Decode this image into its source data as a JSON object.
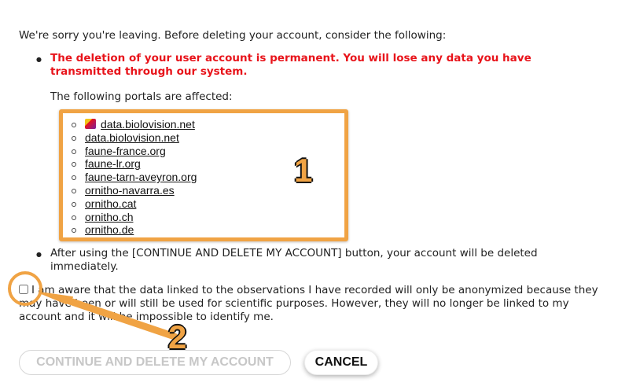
{
  "intro": "We're sorry you're leaving. Before deleting your account, consider the following:",
  "warning": "The deletion of your user account is permanent. You will lose any data you have transmitted through our system.",
  "affected_label": "The following portals are affected:",
  "portals": [
    "data.biolovision.net",
    "data.biolovision.net",
    "faune-france.org",
    "faune-lr.org",
    "faune-tarn-aveyron.org",
    "ornitho-navarra.es",
    "ornitho.cat",
    "ornitho.ch",
    "ornitho.de"
  ],
  "after_text": "After using the [CONTINUE AND DELETE MY ACCOUNT] button, your account will be deleted immediately.",
  "consent_text": "I am aware that the data linked to the observations I have recorded will only be anonymized because they may have been or will still be used for scientific purposes. However, they will no longer be linked to my account and it will be impossible to identify me.",
  "consent_checked": false,
  "annotation_1": "1",
  "annotation_2": "2",
  "buttons": {
    "continue": "CONTINUE AND DELETE MY ACCOUNT",
    "cancel": "CANCEL"
  },
  "colors": {
    "warning": "#e8141b",
    "annotation": "#f0a344"
  }
}
